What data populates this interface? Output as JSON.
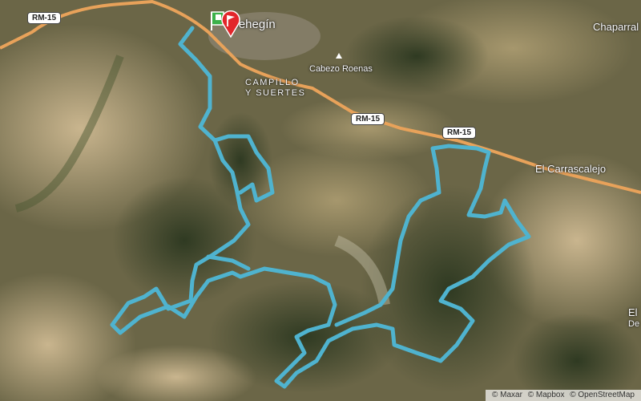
{
  "map": {
    "towns": [
      {
        "name": "Cehegín"
      },
      {
        "name": "Chaparral"
      },
      {
        "name": "El Carrascalejo"
      },
      {
        "name": "El"
      },
      {
        "name": "De"
      }
    ],
    "district": {
      "line1": "CAMPILLO",
      "line2": "Y SUERTES"
    },
    "peak": {
      "name": "Cabezo Roenas"
    },
    "road_shields": [
      "RM-15",
      "RM-15",
      "RM-15"
    ],
    "route": {
      "color": "#4fb3cf"
    },
    "road": {
      "color": "#e8a25a"
    },
    "markers": {
      "start_icon": "start-flag-icon",
      "end_icon": "finish-flag-icon",
      "start_color": "#3cb14a",
      "end_color": "#e2262b"
    },
    "attribution": [
      "© Maxar",
      "© Mapbox",
      "© OpenStreetMap"
    ]
  }
}
